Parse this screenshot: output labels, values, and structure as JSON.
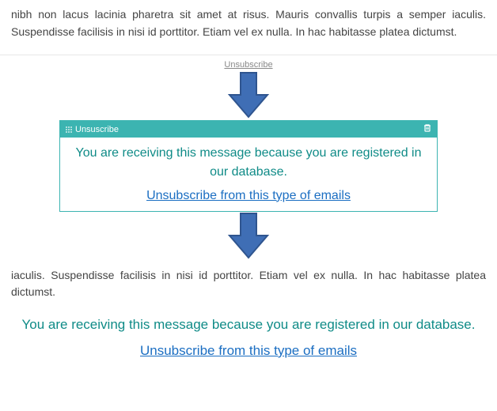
{
  "paragraph1": "nibh non lacus lacinia pharetra sit amet at risus. Mauris convallis turpis a semper iaculis. Suspendisse facilisis in nisi id porttitor. Etiam vel ex nulla. In hac habitasse platea dictumst.",
  "topUnsubscribe": "Unsubscribe",
  "component": {
    "headerLabel": "Unsuscribe",
    "message": "You are receiving this message because you are registered in our database.",
    "linkText": "Unsubscribe from this type of emails"
  },
  "paragraph2": "iaculis. Suspendisse facilisis in nisi id porttitor. Etiam vel ex nulla. In hac habitasse platea dictumst.",
  "finalBlock": {
    "message": "You are receiving this message because you are registered in our database.",
    "linkText": "Unsubscribe from this type of emails"
  }
}
